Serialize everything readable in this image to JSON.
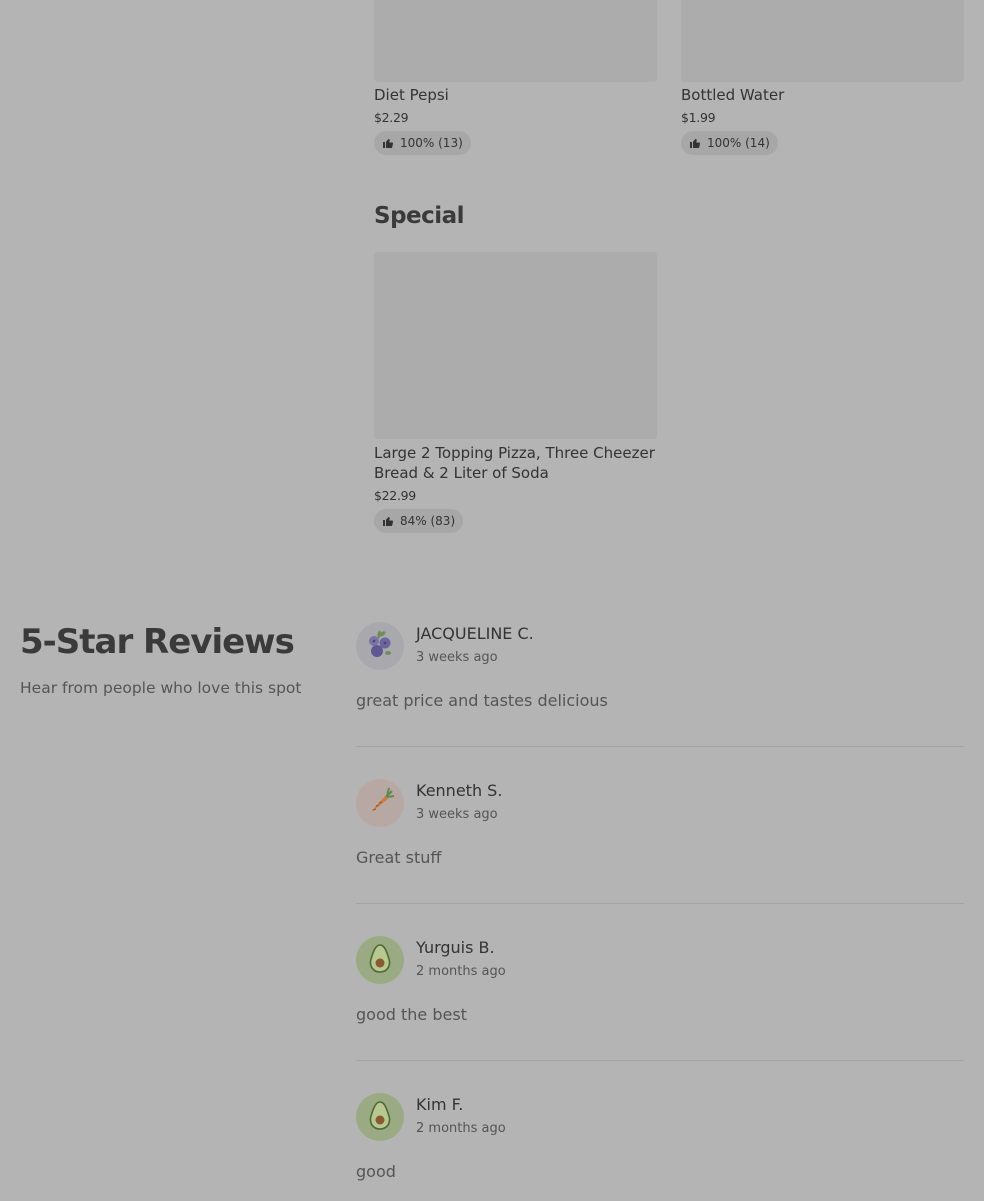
{
  "drinks": {
    "items": [
      {
        "name": "Diet Pepsi",
        "price": "$2.29",
        "rating": "100% (13)"
      },
      {
        "name": "Bottled Water",
        "price": "$1.99",
        "rating": "100% (14)"
      }
    ]
  },
  "special": {
    "title": "Special",
    "items": [
      {
        "name_line1": "Large 2 Topping Pizza, Three Cheezer",
        "name_line2": "Bread & 2 Liter of Soda",
        "price": "$22.99",
        "rating": "84% (83)"
      }
    ]
  },
  "reviews": {
    "heading": "5-Star Reviews",
    "subheading": "Hear from people who love this spot",
    "items": [
      {
        "name": "JACQUELINE C.",
        "time": "3 weeks ago",
        "text": "great price and tastes delicious",
        "avatar_icon": "blueberry-icon"
      },
      {
        "name": "Kenneth S.",
        "time": "3 weeks ago",
        "text": "Great stuff",
        "avatar_icon": "carrot-icon"
      },
      {
        "name": "Yurguis B.",
        "time": "2 months ago",
        "text": "good the best",
        "avatar_icon": "avocado-icon"
      },
      {
        "name": "Kim F.",
        "time": "2 months ago",
        "text": "good",
        "avatar_icon": "avocado-icon"
      }
    ]
  },
  "colors": {
    "background": "#b4b4b4",
    "placeholder": "#acacac",
    "pill": "#a7a7a7"
  }
}
